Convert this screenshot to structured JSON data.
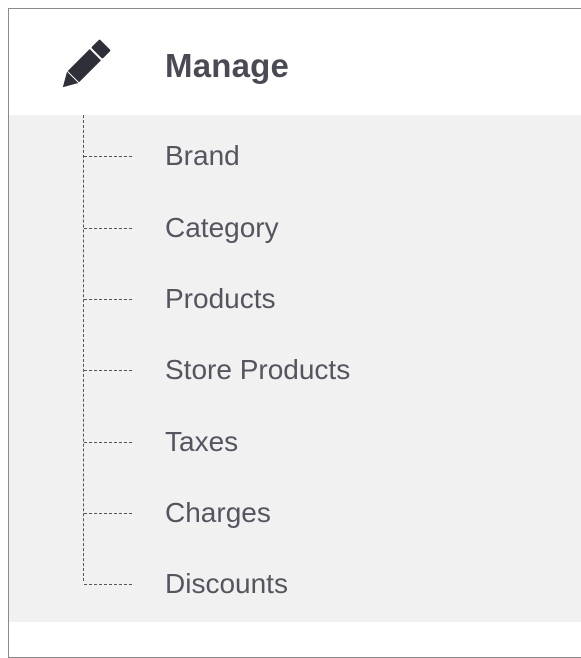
{
  "menu": {
    "title": "Manage",
    "icon": "pencil-icon",
    "items": [
      {
        "label": "Brand"
      },
      {
        "label": "Category"
      },
      {
        "label": "Products"
      },
      {
        "label": "Store Products"
      },
      {
        "label": "Taxes"
      },
      {
        "label": "Charges"
      },
      {
        "label": "Discounts"
      }
    ]
  },
  "colors": {
    "title_text": "#4a4a55",
    "item_text": "#555560",
    "submenu_background": "#f1f1f1",
    "icon": "#2f2f3a"
  }
}
